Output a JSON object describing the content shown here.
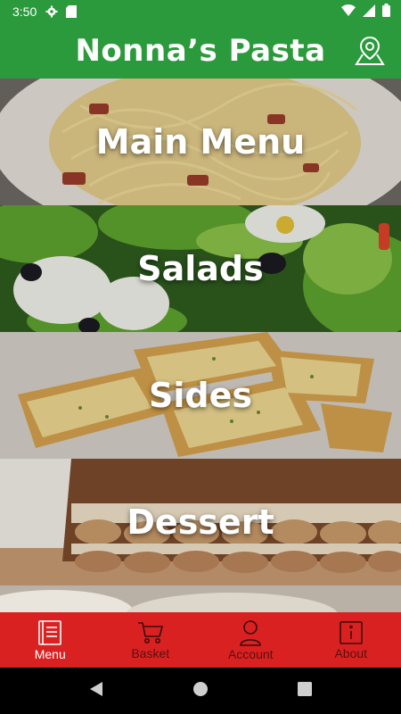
{
  "status_bar": {
    "time": "3:50",
    "left_icons": [
      "settings-icon",
      "sd-card-icon"
    ],
    "right_icons": [
      "wifi-icon",
      "signal-icon",
      "battery-icon"
    ]
  },
  "header": {
    "title": "Nonna’s Pasta",
    "action_icon": "map-location-icon",
    "background": "#2b9a3c"
  },
  "categories": [
    {
      "label": "Main Menu",
      "image": "spaghetti-carbonara"
    },
    {
      "label": "Salads",
      "image": "green-salad"
    },
    {
      "label": "Sides",
      "image": "garlic-bread"
    },
    {
      "label": "Dessert",
      "image": "tiramisu"
    }
  ],
  "bottom_nav": {
    "background": "#d92121",
    "items": [
      {
        "label": "Menu",
        "icon": "menu-book-icon",
        "active": true
      },
      {
        "label": "Basket",
        "icon": "cart-icon",
        "active": false
      },
      {
        "label": "Account",
        "icon": "person-icon",
        "active": false
      },
      {
        "label": "About",
        "icon": "info-icon",
        "active": false
      }
    ]
  },
  "system_nav": [
    "back-icon",
    "home-icon",
    "recents-icon"
  ]
}
